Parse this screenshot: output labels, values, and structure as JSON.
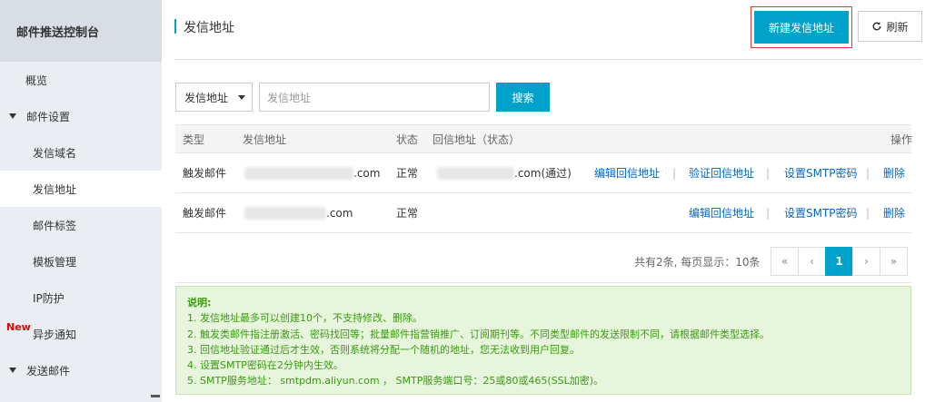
{
  "sidebar": {
    "title": "邮件推送控制台",
    "items": [
      {
        "label": "概览"
      },
      {
        "label": "邮件设置"
      },
      {
        "label": "发信域名"
      },
      {
        "label": "发信地址"
      },
      {
        "label": "邮件标签"
      },
      {
        "label": "模板管理"
      },
      {
        "label": "IP防护"
      },
      {
        "label": "异步通知",
        "badge": "New"
      },
      {
        "label": "发送邮件"
      }
    ]
  },
  "header": {
    "title": "发信地址",
    "new_button": "新建发信地址",
    "refresh_button": "刷新"
  },
  "search": {
    "select_value": "发信地址",
    "placeholder": "发信地址",
    "button": "搜索"
  },
  "table": {
    "columns": [
      "类型",
      "发信地址",
      "状态",
      "回信地址（状态）",
      "操作"
    ],
    "rows": [
      {
        "type": "触发邮件",
        "address_suffix": ".com",
        "status": "正常",
        "reply_suffix": ".com(通过)",
        "actions": [
          "编辑回信地址",
          "验证回信地址",
          "设置SMTP密码",
          "删除"
        ]
      },
      {
        "type": "触发邮件",
        "address_suffix": ".com",
        "status": "正常",
        "reply_suffix": "",
        "actions": [
          "编辑回信地址",
          "设置SMTP密码",
          "删除"
        ]
      }
    ],
    "separator": "|"
  },
  "pager": {
    "info": "共有2条, 每页显示：10条",
    "first": "«",
    "prev": "‹",
    "current": "1",
    "next": "›",
    "last": "»"
  },
  "notes": {
    "title": "说明:",
    "lines": [
      "1. 发信地址最多可以创建10个，不支持修改、删除。",
      "2. 触发类邮件指注册激活、密码找回等；批量邮件指营销推广、订阅期刊等。不同类型邮件的发送限制不同，请根据邮件类型选择。",
      "3. 回信地址验证通过后才生效，否则系统将分配一个随机的地址，您无法收到用户回复。",
      "4. 设置SMTP密码在2分钟内生效。",
      "5. SMTP服务地址： smtpdm.aliyun.com ， SMTP服务端口号：25或80或465(SSL加密)。"
    ]
  },
  "colors": {
    "accent": "#00a2ca",
    "link": "#0066cc",
    "note_text": "#3a9a10",
    "highlight_border": "#ee3333"
  }
}
